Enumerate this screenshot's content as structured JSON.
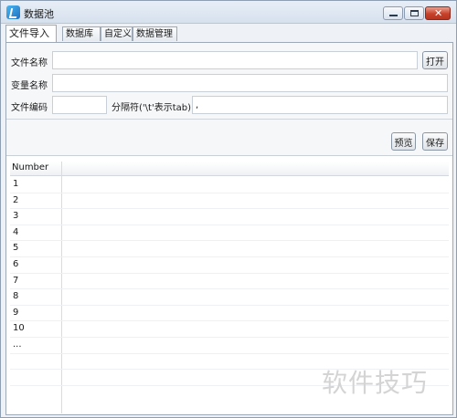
{
  "window": {
    "title": "数据池"
  },
  "tabs": [
    {
      "label": "文件导入",
      "active": true
    },
    {
      "label": "数据库",
      "active": false
    },
    {
      "label": "自定义",
      "active": false
    },
    {
      "label": "数据管理",
      "active": false
    }
  ],
  "form": {
    "file_name_label": "文件名称",
    "file_name_value": "",
    "open_button": "打开",
    "var_name_label": "变量名称",
    "var_name_value": "",
    "encoding_label": "文件编码",
    "encoding_value": "",
    "delimiter_label": "分隔符('\\t'表示tab)",
    "delimiter_value": ","
  },
  "actions": {
    "preview_button": "预览",
    "save_button": "保存"
  },
  "table": {
    "column_header": "Number",
    "rows": [
      "1",
      "2",
      "3",
      "4",
      "5",
      "6",
      "7",
      "8",
      "9",
      "10",
      "...",
      "",
      ""
    ]
  },
  "watermark": "软件技巧"
}
